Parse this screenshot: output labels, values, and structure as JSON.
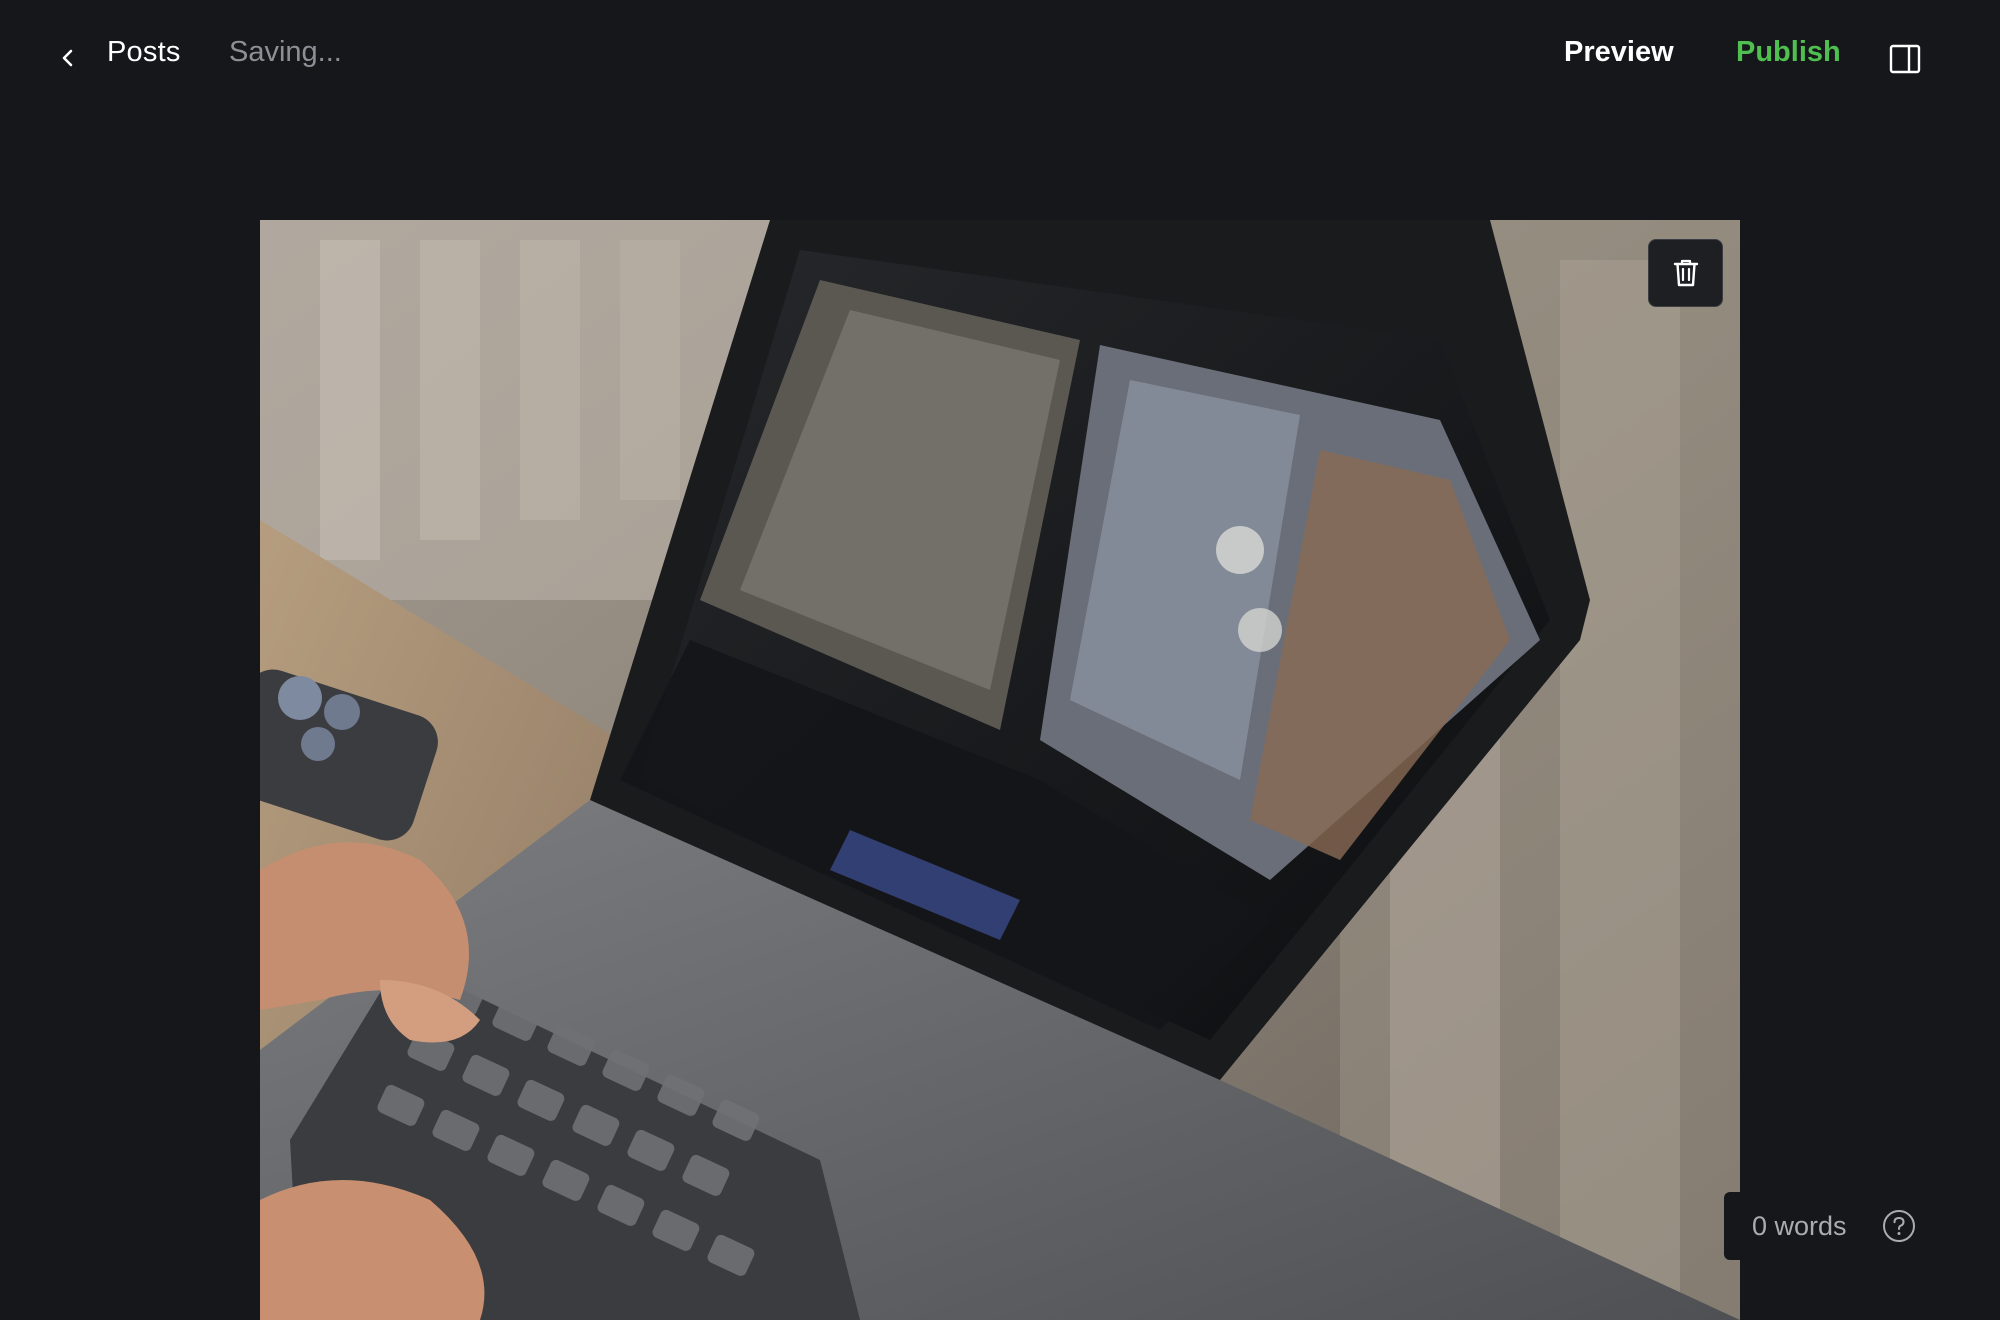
{
  "header": {
    "back_label": "Posts",
    "status": "Saving...",
    "preview_label": "Preview",
    "publish_label": "Publish",
    "sidebar_toggle_icon": "sidebar-panel-icon",
    "back_icon": "chevron-left-icon"
  },
  "editor": {
    "feature_image_alt": "Laptop being used on a desk",
    "delete_icon": "trash-icon"
  },
  "footer": {
    "word_count": "0 words",
    "help_icon": "help-circle-icon"
  },
  "colors": {
    "background": "#15171a",
    "text": "#ffffff",
    "muted": "#8c9096",
    "publish": "#4fbf4f"
  }
}
